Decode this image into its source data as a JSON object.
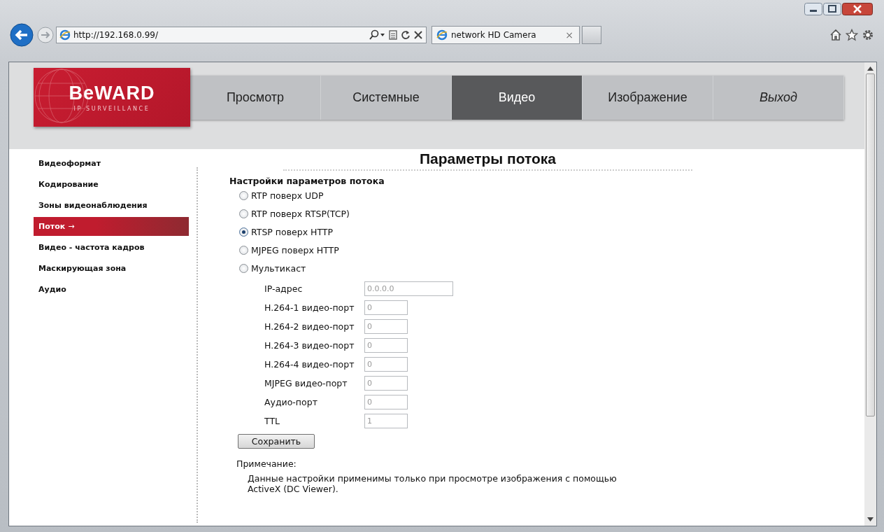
{
  "browser": {
    "address": "http://192.168.0.99/",
    "tab_title": "network HD Camera",
    "tab_close": "×"
  },
  "logo": {
    "brand": "BeWARD",
    "tagline": "IP SURVEILLANCE"
  },
  "nav": [
    {
      "label": "Просмотр",
      "selected": false,
      "kind": "page"
    },
    {
      "label": "Системные",
      "selected": false,
      "kind": "page"
    },
    {
      "label": "Видео",
      "selected": true,
      "kind": "page"
    },
    {
      "label": "Изображение",
      "selected": false,
      "kind": "page"
    },
    {
      "label": "Выход",
      "selected": false,
      "kind": "logout"
    }
  ],
  "sidebar": [
    {
      "label": "Видеоформат",
      "selected": false
    },
    {
      "label": "Кодирование",
      "selected": false
    },
    {
      "label": "Зоны видеонаблюдения",
      "selected": false
    },
    {
      "label": "Поток",
      "selected": true,
      "arrow": "→"
    },
    {
      "label": "Видео - частота кадров",
      "selected": false
    },
    {
      "label": "Маскирующая зона",
      "selected": false
    },
    {
      "label": "Аудио",
      "selected": false
    }
  ],
  "title": "Параметры потока",
  "section": "Настройки параметров потока",
  "protocols": [
    {
      "label": "RTP поверх UDP",
      "selected": false
    },
    {
      "label": "RTP поверх RTSP(TCP)",
      "selected": false
    },
    {
      "label": "RTSP поверх HTTP",
      "selected": true
    },
    {
      "label": "MJPEG поверх HTTP",
      "selected": false
    },
    {
      "label": "Мультикаст",
      "selected": false
    }
  ],
  "fields": [
    {
      "label": "IP-адрес",
      "value": "0.0.0.0",
      "kind": "wide"
    },
    {
      "label": "H.264-1 видео-порт",
      "value": "0",
      "kind": "narrow"
    },
    {
      "label": "H.264-2 видео-порт",
      "value": "0",
      "kind": "narrow"
    },
    {
      "label": "H.264-3 видео-порт",
      "value": "0",
      "kind": "narrow"
    },
    {
      "label": "H.264-4 видео-порт",
      "value": "0",
      "kind": "narrow"
    },
    {
      "label": "MJPEG видео-порт",
      "value": "0",
      "kind": "narrow"
    },
    {
      "label": "Аудио-порт",
      "value": "0",
      "kind": "narrow"
    },
    {
      "label": "TTL",
      "value": "1",
      "kind": "narrow"
    }
  ],
  "save": "Сохранить",
  "note_label": "Примечание:",
  "note": "Данные настройки применимы только при просмотре изображения с помощью ActiveX (DC Viewer)."
}
